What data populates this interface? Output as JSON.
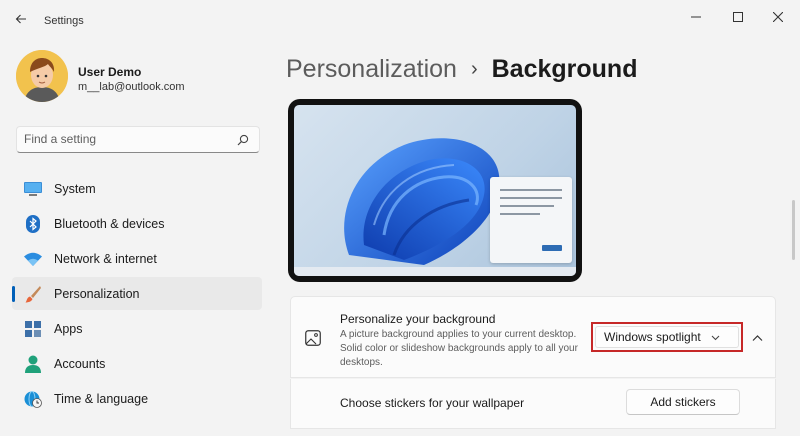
{
  "window": {
    "title": "Settings",
    "icons": {
      "back": "back-arrow-icon",
      "minimize": "minimize-icon",
      "maximize": "maximize-icon",
      "close": "close-icon"
    }
  },
  "profile": {
    "name": "User Demo",
    "email": "m__lab@outlook.com"
  },
  "search": {
    "placeholder": "Find a setting",
    "icon": "search-icon"
  },
  "sidebar": {
    "items": [
      {
        "label": "System",
        "icon": "monitor-icon",
        "active": false
      },
      {
        "label": "Bluetooth & devices",
        "icon": "bluetooth-icon",
        "active": false
      },
      {
        "label": "Network & internet",
        "icon": "wifi-icon",
        "active": false
      },
      {
        "label": "Personalization",
        "icon": "brush-icon",
        "active": true
      },
      {
        "label": "Apps",
        "icon": "apps-icon",
        "active": false
      },
      {
        "label": "Accounts",
        "icon": "person-icon",
        "active": false
      },
      {
        "label": "Time & language",
        "icon": "globe-clock-icon",
        "active": false
      }
    ]
  },
  "breadcrumb": {
    "parent": "Personalization",
    "separator": "›",
    "current": "Background"
  },
  "background_card": {
    "title": "Personalize your background",
    "description": "A picture background applies to your current desktop. Solid color or slideshow backgrounds apply to all your desktops.",
    "dropdown_value": "Windows spotlight",
    "icon": "image-icon"
  },
  "stickers_card": {
    "label": "Choose stickers for your wallpaper",
    "button": "Add stickers"
  },
  "colors": {
    "accent": "#005fb8",
    "highlight": "#c62828",
    "background": "#f3f3f3",
    "card": "#fbfbfb",
    "wallpaper_bloom": "#1e5fe0"
  }
}
